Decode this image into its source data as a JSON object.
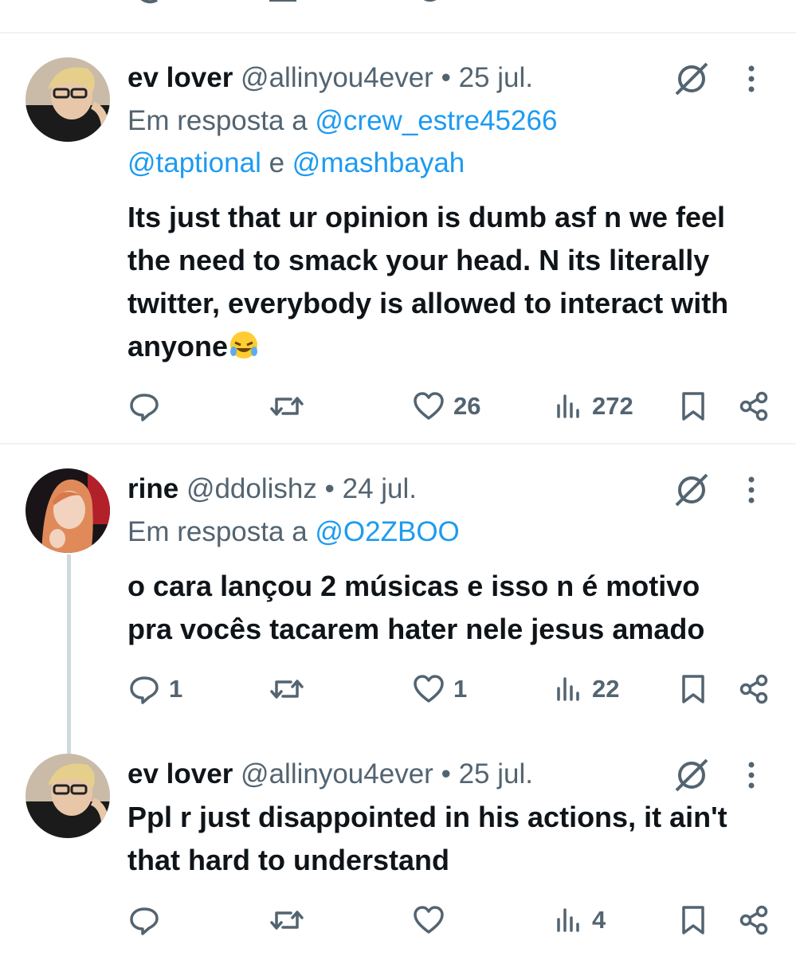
{
  "tweets": [
    {
      "name": "ev lover",
      "handle": "@allinyou4ever",
      "separator": "•",
      "date": "25 jul.",
      "reply_prefix": "Em resposta a",
      "mention1": "@crew_estre45266",
      "mention2": "@taptional",
      "conjunction": "e",
      "mention3": "@mashbayah",
      "text": "Its just that ur opinion is dumb asf n we feel the need to smack your head. N its literally twitter, everybody is allowed to interact with anyone",
      "emoji": "rolling-on-floor-laughing",
      "replies": "",
      "retweets": "",
      "likes": "26",
      "views": "272"
    },
    {
      "name": "rine",
      "handle": "@ddolishz",
      "separator": "•",
      "date": "24 jul.",
      "reply_prefix": "Em resposta a",
      "mention1": "@O2ZBOO",
      "text": "o cara lançou 2 músicas e isso n é motivo pra vocês tacarem hater nele jesus amado",
      "replies": "1",
      "retweets": "",
      "likes": "1",
      "views": "22"
    },
    {
      "name": "ev lover",
      "handle": "@allinyou4ever",
      "separator": "•",
      "date": "25 jul.",
      "text": "Ppl r just disappointed in his actions, it ain't that hard to understand",
      "replies": "",
      "retweets": "",
      "likes": "",
      "views": "4"
    }
  ],
  "icons": {
    "reply": "reply-icon",
    "retweet": "retweet-icon",
    "like": "heart-icon",
    "views": "views-icon",
    "bookmark": "bookmark-icon",
    "share": "share-icon",
    "grok": "grok-icon",
    "more": "more-icon"
  },
  "colors": {
    "text": "#0f1419",
    "secondary": "#536471",
    "link": "#1d9bf0",
    "divider": "#eff3f4",
    "thread_line": "#cfd9de"
  }
}
